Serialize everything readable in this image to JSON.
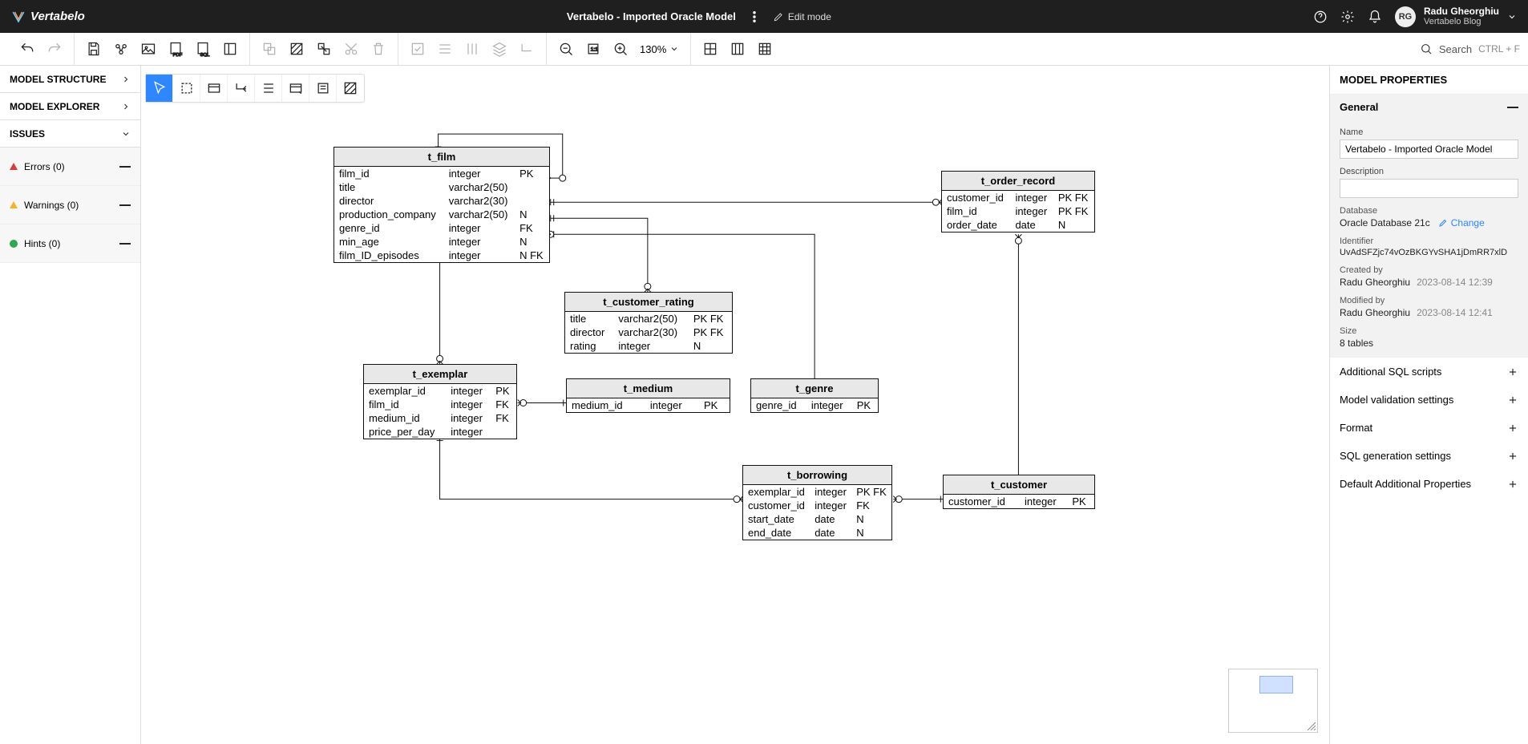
{
  "header": {
    "brand": "Vertabelo",
    "doc_title": "Vertabelo - Imported Oracle Model",
    "edit_mode": "Edit mode",
    "user_initials": "RG",
    "user_name": "Radu Gheorghiu",
    "user_sub": "Vertabelo Blog"
  },
  "toolbar": {
    "zoom": "130%",
    "search_placeholder": "Search",
    "search_shortcut": "CTRL + F"
  },
  "left_panel": {
    "model_structure": "MODEL STRUCTURE",
    "model_explorer": "MODEL EXPLORER",
    "issues": "ISSUES",
    "errors": "Errors (0)",
    "warnings": "Warnings (0)",
    "hints": "Hints (0)"
  },
  "entities": {
    "t_film": {
      "name": "t_film",
      "cols": [
        [
          "film_id",
          "integer",
          "PK"
        ],
        [
          "title",
          "varchar2(50)",
          ""
        ],
        [
          "director",
          "varchar2(30)",
          ""
        ],
        [
          "production_company",
          "varchar2(50)",
          "N"
        ],
        [
          "genre_id",
          "integer",
          "FK"
        ],
        [
          "min_age",
          "integer",
          "N"
        ],
        [
          "film_ID_episodes",
          "integer",
          "N FK"
        ]
      ]
    },
    "t_order_record": {
      "name": "t_order_record",
      "cols": [
        [
          "customer_id",
          "integer",
          "PK FK"
        ],
        [
          "film_id",
          "integer",
          "PK FK"
        ],
        [
          "order_date",
          "date",
          "N"
        ]
      ]
    },
    "t_customer_rating": {
      "name": "t_customer_rating",
      "cols": [
        [
          "title",
          "varchar2(50)",
          "PK FK"
        ],
        [
          "director",
          "varchar2(30)",
          "PK FK"
        ],
        [
          "rating",
          "integer",
          "N"
        ]
      ]
    },
    "t_exemplar": {
      "name": "t_exemplar",
      "cols": [
        [
          "exemplar_id",
          "integer",
          "PK"
        ],
        [
          "film_id",
          "integer",
          "FK"
        ],
        [
          "medium_id",
          "integer",
          "FK"
        ],
        [
          "price_per_day",
          "integer",
          ""
        ]
      ]
    },
    "t_medium": {
      "name": "t_medium",
      "cols": [
        [
          "medium_id",
          "integer",
          "PK"
        ]
      ]
    },
    "t_genre": {
      "name": "t_genre",
      "cols": [
        [
          "genre_id",
          "integer",
          "PK"
        ]
      ]
    },
    "t_borrowing": {
      "name": "t_borrowing",
      "cols": [
        [
          "exemplar_id",
          "integer",
          "PK FK"
        ],
        [
          "customer_id",
          "integer",
          "FK"
        ],
        [
          "start_date",
          "date",
          "N"
        ],
        [
          "end_date",
          "date",
          "N"
        ]
      ]
    },
    "t_customer": {
      "name": "t_customer",
      "cols": [
        [
          "customer_id",
          "integer",
          "PK"
        ]
      ]
    }
  },
  "right_panel": {
    "title": "MODEL PROPERTIES",
    "general": "General",
    "name_label": "Name",
    "name_value": "Vertabelo - Imported Oracle Model",
    "desc_label": "Description",
    "desc_value": "",
    "database_label": "Database",
    "database_value": "Oracle Database 21c",
    "change": "Change",
    "identifier_label": "Identifier",
    "identifier_value": "UvAdSFZjc74vOzBKGYvSHA1jDmRR7xlD",
    "created_label": "Created by",
    "created_by": "Radu Gheorghiu",
    "created_at": "2023-08-14 12:39",
    "modified_label": "Modified by",
    "modified_by": "Radu Gheorghiu",
    "modified_at": "2023-08-14 12:41",
    "size_label": "Size",
    "size_value": "8 tables",
    "sec_sql": "Additional SQL scripts",
    "sec_validation": "Model validation settings",
    "sec_format": "Format",
    "sec_sqlgen": "SQL generation settings",
    "sec_addprops": "Default Additional Properties"
  }
}
